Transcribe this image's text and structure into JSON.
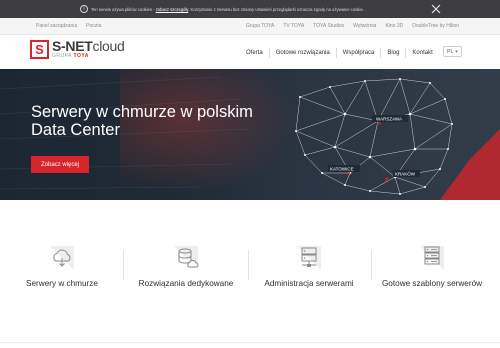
{
  "cookie_bar": {
    "text_before": "Ten serwis używa plików cookies - ",
    "link": "zobacz szczegóły",
    "text_after": ". Korzystanie z Serwisu bez zmiany ustawień przeglądarki oznacza zgodę na używanie cookie."
  },
  "utility_nav": {
    "left": [
      "Panel zarządzania",
      "Poczta"
    ],
    "right": [
      "Grupa TOYA",
      "TV TOYA",
      "TOYA Studios",
      "Wytwórnia",
      "Kino 3D",
      "DoubleTree by Hilton"
    ]
  },
  "logo": {
    "mark": "S",
    "name_bold": "S-NET",
    "name_light": "cloud",
    "group_prefix": "GRUPA ",
    "group_brand": "TOYA"
  },
  "main_nav": [
    "Oferta",
    "Gotowe rozwiązania",
    "Współpraca",
    "Blog",
    "Kontakt"
  ],
  "language": {
    "label": "PL"
  },
  "hero": {
    "title": "Serwery w chmurze w polskim Data Center",
    "button": "Zobacz więcej",
    "cities": [
      "WARSZAWA",
      "KATOWICE",
      "KRAKÓW"
    ]
  },
  "services": [
    {
      "label": "Serwery w chmurze",
      "icon": "cloud-server-icon"
    },
    {
      "label": "Rozwiązania dedykowane",
      "icon": "database-cloud-icon"
    },
    {
      "label": "Administracja serwerami",
      "icon": "server-admin-icon"
    },
    {
      "label": "Gotowe szablony serwerów",
      "icon": "server-templates-icon"
    }
  ],
  "colors": {
    "brand_red": "#d7262b",
    "cookie_bg": "#3e3e40",
    "hero_bg": "#1f2a36",
    "text_dark": "#2f2f2f"
  }
}
